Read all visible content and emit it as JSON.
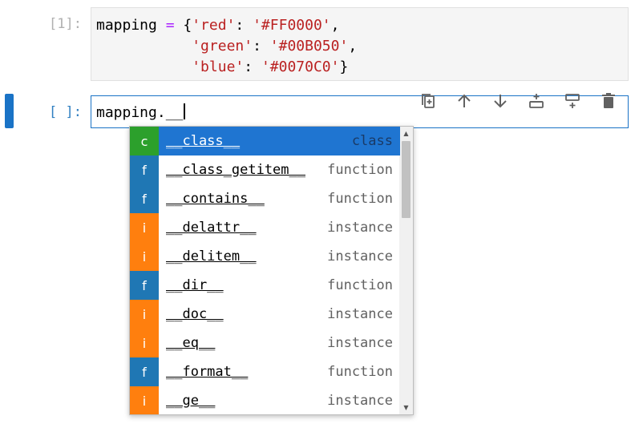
{
  "cells": {
    "executed": {
      "prompt": "[1]:",
      "line1": {
        "var": "mapping",
        "op": " = ",
        "brace": "{",
        "key": "'red'",
        "sep": ": ",
        "val": "'#FF0000'",
        "end": ","
      },
      "line2": {
        "indent": "           ",
        "key": "'green'",
        "sep": ": ",
        "val": "'#00B050'",
        "end": ","
      },
      "line3": {
        "indent": "           ",
        "key": "'blue'",
        "sep": ": ",
        "val": "'#0070C0'",
        "end": "}"
      }
    },
    "active": {
      "prompt": "[ ]:",
      "input": "mapping.__"
    }
  },
  "toolbar": {
    "icons": [
      "duplicate-icon",
      "move-up-icon",
      "move-down-icon",
      "insert-above-icon",
      "insert-below-icon",
      "delete-icon"
    ]
  },
  "completer": {
    "selected_index": 0,
    "items": [
      {
        "badge": "c",
        "badge_color": "#2ca02c",
        "name": "__class__",
        "type": "class"
      },
      {
        "badge": "f",
        "badge_color": "#1f77b4",
        "name": "__class_getitem__",
        "type": "function"
      },
      {
        "badge": "f",
        "badge_color": "#1f77b4",
        "name": "__contains__",
        "type": "function"
      },
      {
        "badge": "i",
        "badge_color": "#ff7f0e",
        "name": "__delattr__",
        "type": "instance"
      },
      {
        "badge": "i",
        "badge_color": "#ff7f0e",
        "name": "__delitem__",
        "type": "instance"
      },
      {
        "badge": "f",
        "badge_color": "#1f77b4",
        "name": "__dir__",
        "type": "function"
      },
      {
        "badge": "i",
        "badge_color": "#ff7f0e",
        "name": "__doc__",
        "type": "instance"
      },
      {
        "badge": "i",
        "badge_color": "#ff7f0e",
        "name": "__eq__",
        "type": "instance"
      },
      {
        "badge": "f",
        "badge_color": "#1f77b4",
        "name": "__format__",
        "type": "function"
      },
      {
        "badge": "i",
        "badge_color": "#ff7f0e",
        "name": "__ge__",
        "type": "instance"
      }
    ]
  },
  "colors": {
    "accent": "#1a73c6",
    "selected_row": "#1f75d1",
    "string": "#ba2121",
    "operator": "#aa22ff"
  }
}
